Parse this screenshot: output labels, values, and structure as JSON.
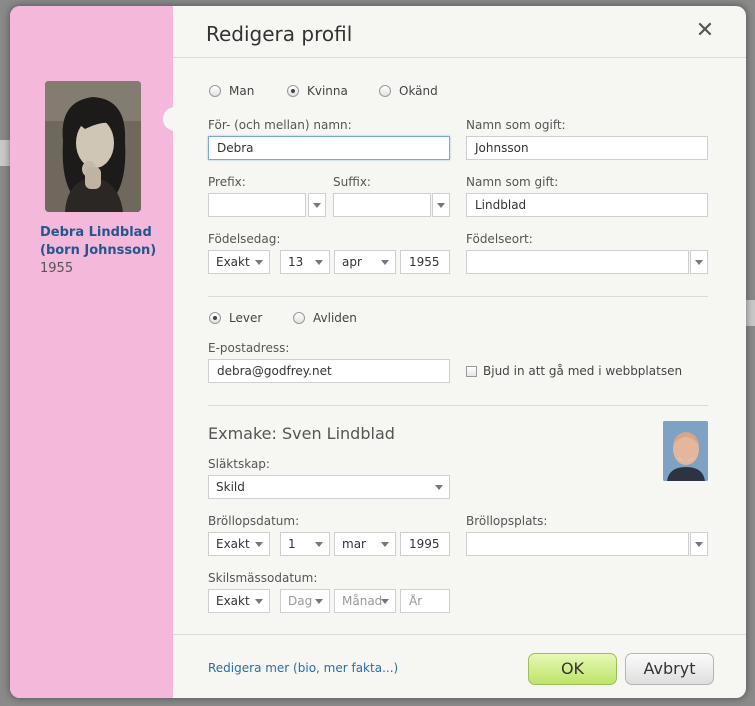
{
  "dialog": {
    "title": "Redigera profil"
  },
  "sidebar": {
    "name_line1": "Debra Lindblad",
    "name_line2": "(born Johnsson)",
    "year": "1955"
  },
  "gender": {
    "options": [
      "Man",
      "Kvinna",
      "Okänd"
    ],
    "selected": "Kvinna"
  },
  "fields": {
    "first_name_label": "För- (och mellan) namn:",
    "first_name_value": "Debra",
    "maiden_label": "Namn som ogift:",
    "maiden_value": "Johnsson",
    "prefix_label": "Prefix:",
    "suffix_label": "Suffix:",
    "married_label": "Namn som gift:",
    "married_value": "Lindblad",
    "birthdate_label": "Födelsedag:",
    "birth_precision": "Exakt",
    "birth_day": "13",
    "birth_month": "apr",
    "birth_year": "1955",
    "birthplace_label": "Födelseort:"
  },
  "status": {
    "options": [
      "Lever",
      "Avliden"
    ],
    "selected": "Lever"
  },
  "email": {
    "label": "E-postadress:",
    "value": "debra@godfrey.net",
    "invite_label": "Bjud in att gå med i webbplatsen"
  },
  "spouse": {
    "title": "Exmake: Sven Lindblad",
    "relation_label": "Släktskap:",
    "relation_value": "Skild",
    "wedding_date_label": "Bröllopsdatum:",
    "wedding_precision": "Exakt",
    "wedding_day": "1",
    "wedding_month": "mar",
    "wedding_year": "1995",
    "wedding_place_label": "Bröllopsplats:",
    "divorce_label": "Skilsmässodatum:",
    "divorce_precision": "Exakt",
    "divorce_day_placeholder": "Dag",
    "divorce_month_placeholder": "Månad",
    "divorce_year_placeholder": "År"
  },
  "footer": {
    "more_link": "Redigera mer (bio, mer fakta...)",
    "ok": "OK",
    "cancel": "Avbryt"
  },
  "icons": {
    "close": "close-icon"
  },
  "colors": {
    "sidebar": "#f4b8da",
    "name": "#23578d",
    "ok_button": "#c8e87d",
    "link": "#2a6ea6"
  }
}
